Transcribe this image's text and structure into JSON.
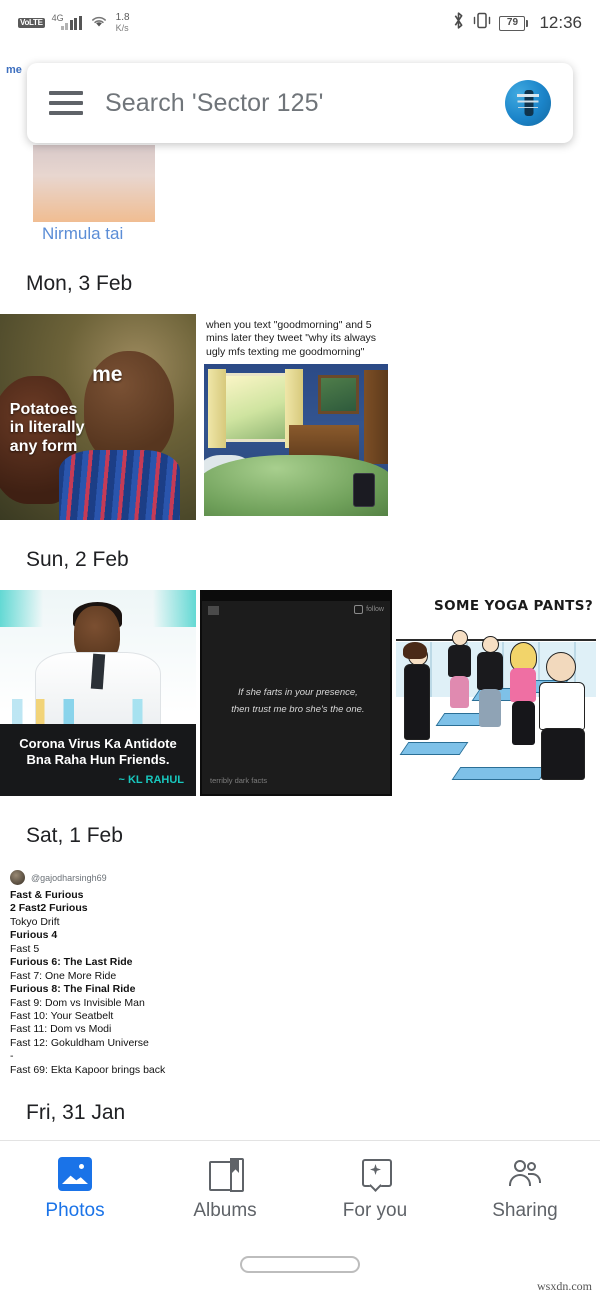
{
  "status_bar": {
    "volte_label": "VoLTE",
    "network_type": "4G",
    "signal_icon": "signal-bars-icon",
    "wifi_icon": "wifi-icon",
    "data_speed_value": "1.8",
    "data_speed_unit": "K/s",
    "bluetooth_icon": "bluetooth-icon",
    "vibrate_icon": "vibrate-icon",
    "battery_level": "79",
    "clock": "12:36"
  },
  "search_bar": {
    "menu_icon": "hamburger-menu-icon",
    "placeholder": "Search 'Sector 125'",
    "avatar_icon": "account-avatar-icon"
  },
  "peek_row": {
    "partial_text": "me"
  },
  "content": {
    "memory_tile": {
      "caption": "Nirmula tai"
    },
    "sections": [
      {
        "date": "Mon, 3 Feb",
        "photos": [
          {
            "name": "potatoes-meme",
            "text_me": "me",
            "text_left": "Potatoes\nin literally\nany form"
          },
          {
            "name": "goodmorning-meme",
            "caption": "when you text \"goodmorning\" and 5 mins later they tweet \"why its always ugly mfs texting me goodmorning\""
          }
        ]
      },
      {
        "date": "Sun, 2 Feb",
        "photos": [
          {
            "name": "kl-rahul-antidote-meme",
            "caption_line1": "Corona Virus Ka Antidote",
            "caption_line2": "Bna Raha Hun Friends.",
            "attribution": "~ KL RAHUL"
          },
          {
            "name": "dark-facts-meme",
            "quote_line1": "If she farts in your presence,",
            "quote_line2": "then trust me bro she's the one.",
            "watermark": "terribly dark facts",
            "source_label": "follow"
          },
          {
            "name": "yoga-pants-cartoon",
            "speech_bubble": "SOME YOGA PANTS?"
          }
        ]
      },
      {
        "date": "Sat, 1 Feb",
        "photos": [
          {
            "name": "fast-furious-tweet",
            "handle": "@gajodharsingh69",
            "lines": [
              "Fast & Furious",
              "2 Fast2 Furious",
              "Tokyo Drift",
              "Furious 4",
              "Fast 5",
              "Furious 6: The Last Ride",
              "Fast 7: One More Ride",
              "Furious 8: The Final Ride",
              "Fast 9: Dom vs Invisible Man",
              "Fast 10: Your Seatbelt",
              "Fast 11: Dom vs Modi",
              "Fast 12: Gokuldham Universe",
              "-",
              "Fast 69: Ekta Kapoor brings back"
            ]
          }
        ]
      },
      {
        "date": "Fri, 31 Jan",
        "photos": []
      }
    ]
  },
  "bottom_nav": {
    "items": [
      {
        "label": "Photos",
        "icon": "photos-icon",
        "active": true
      },
      {
        "label": "Albums",
        "icon": "albums-icon",
        "active": false
      },
      {
        "label": "For you",
        "icon": "for-you-icon",
        "active": false
      },
      {
        "label": "Sharing",
        "icon": "sharing-icon",
        "active": false
      }
    ],
    "active_color": "#1a73e8",
    "inactive_color": "#5f6368"
  },
  "system": {
    "home_indicator": "home-indicator",
    "watermark": "wsxdn.com"
  }
}
